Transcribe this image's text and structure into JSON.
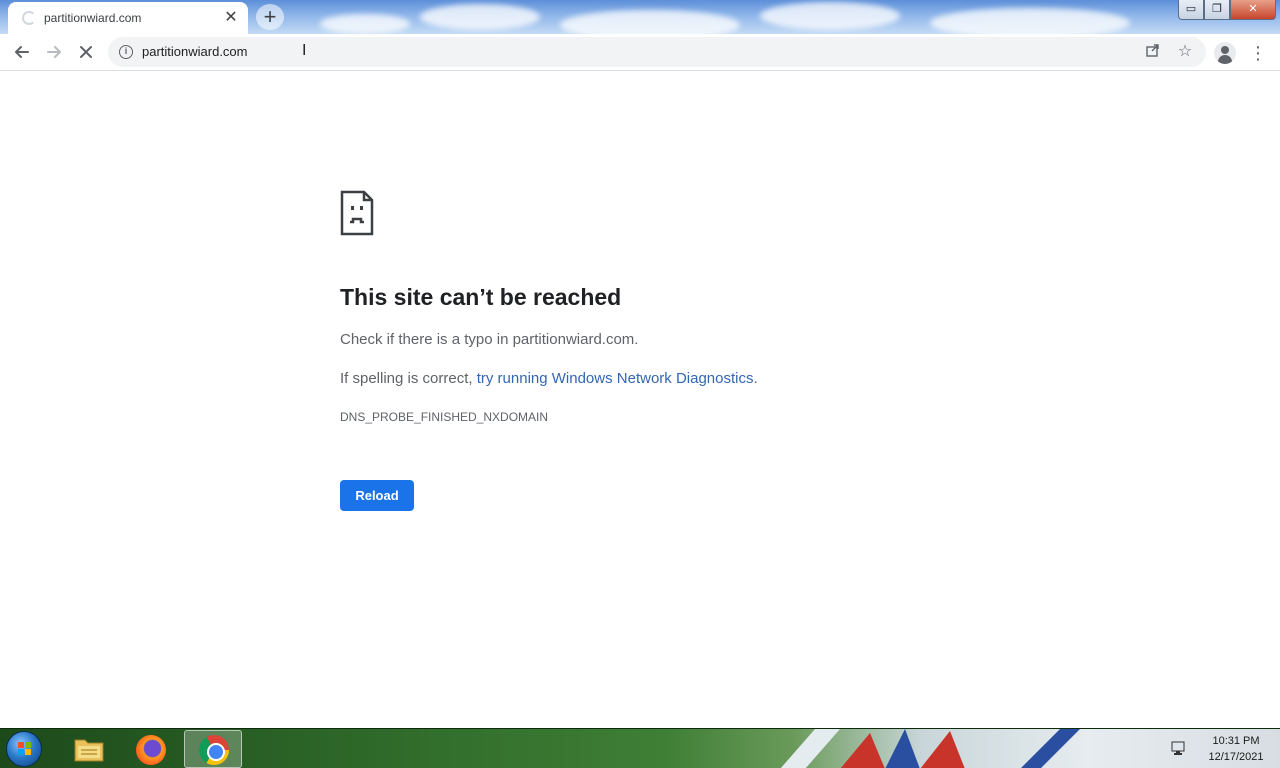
{
  "browser": {
    "tab": {
      "title": "partitionwiard.com"
    },
    "address_bar": {
      "url": "partitionwiard.com"
    },
    "window_controls": {
      "minimize": "▭",
      "maximize": "❐",
      "close": "✕"
    }
  },
  "error_page": {
    "title": "This site can’t be reached",
    "line1": "Check if there is a typo in partitionwiard.com.",
    "line2_prefix": "If spelling is correct, ",
    "line2_link": "try running Windows Network Diagnostics",
    "line2_suffix": ".",
    "error_code": "DNS_PROBE_FINISHED_NXDOMAIN",
    "reload_label": "Reload"
  },
  "taskbar": {
    "apps": [
      "file-explorer",
      "firefox",
      "chrome"
    ],
    "active_app": "chrome",
    "clock_time": "10:31 PM",
    "clock_date": "12/17/2021"
  },
  "colors": {
    "accent": "#1a73e8",
    "link": "#3367b3",
    "title_text": "#202124",
    "body_text": "#5f6368"
  }
}
